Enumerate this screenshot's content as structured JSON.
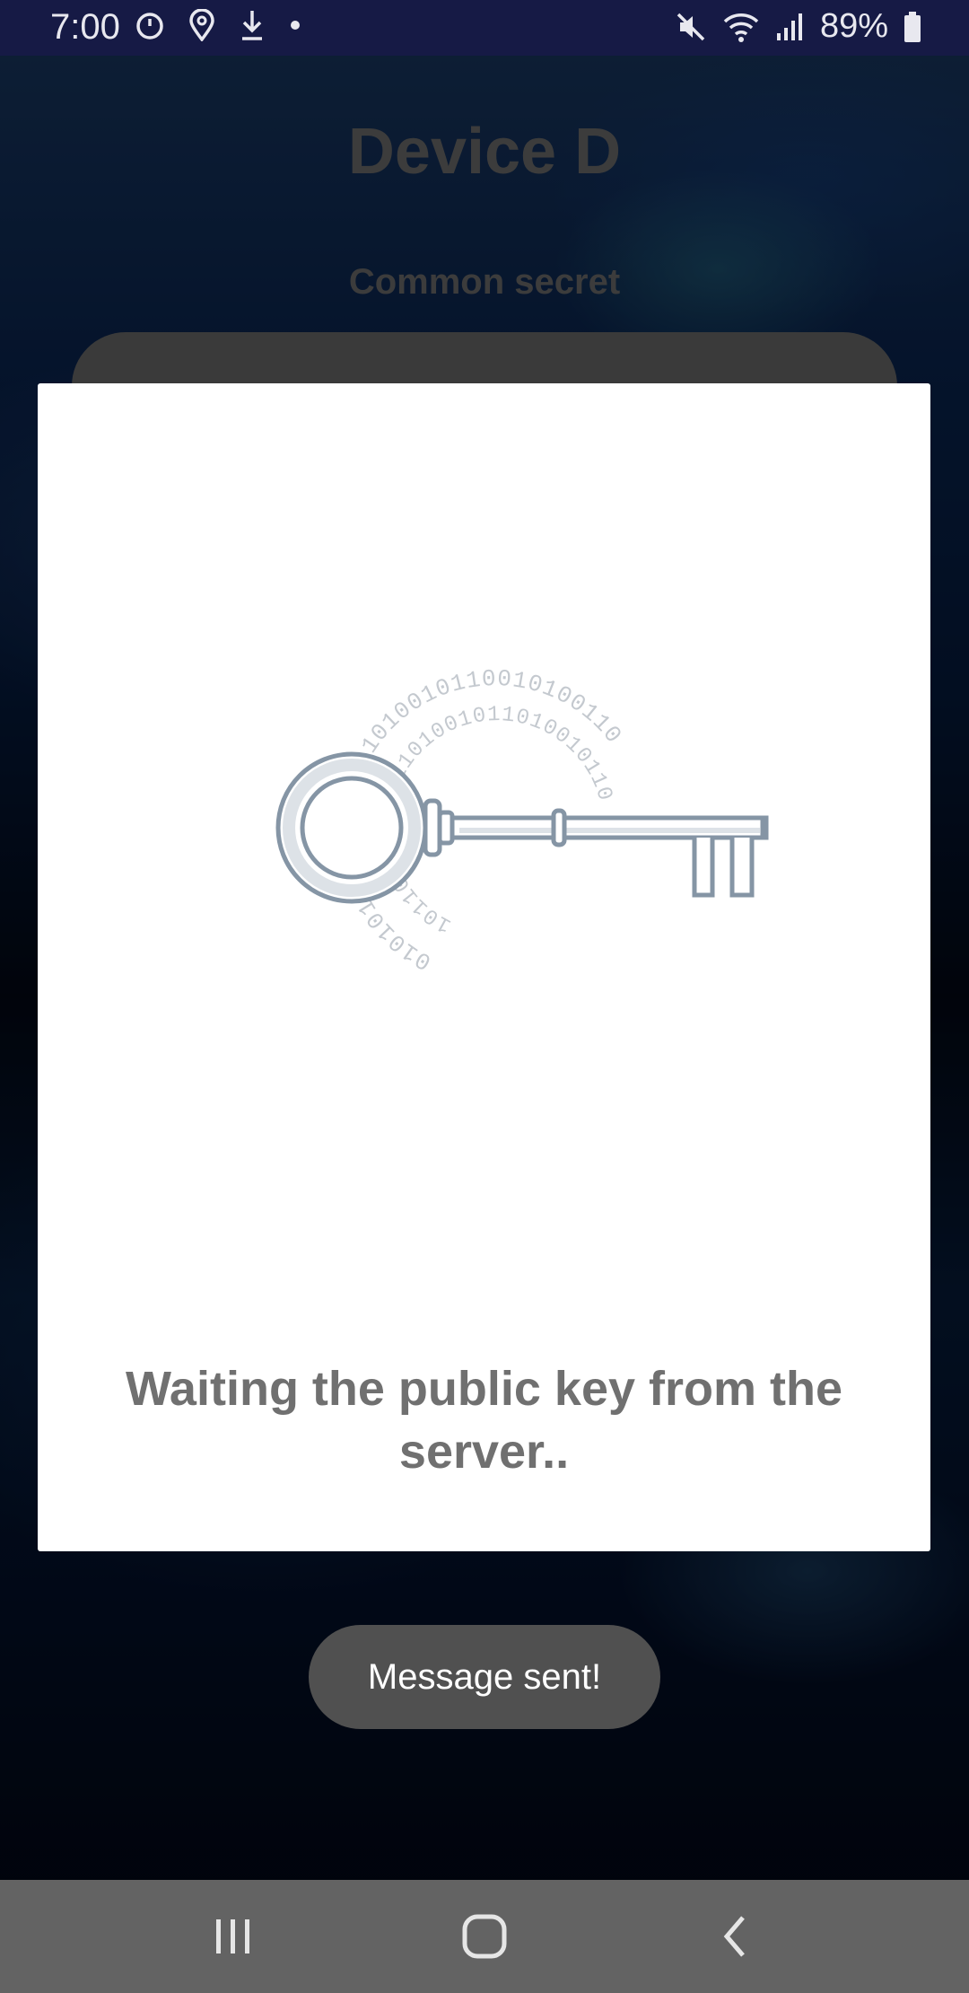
{
  "status_bar": {
    "time": "7:00",
    "battery": "89%",
    "left_icons": [
      "timer-icon",
      "location-icon",
      "download-icon",
      "dot-icon"
    ],
    "right_icons": [
      "mute-icon",
      "wifi-icon",
      "signal-icon",
      "battery-icon"
    ]
  },
  "screen": {
    "title": "Device D",
    "label": "Common secret"
  },
  "dialog": {
    "message": "Waiting the public key from the server..",
    "illustration": "binary-key-icon"
  },
  "toast": {
    "text": "Message sent!"
  },
  "nav_bar": {
    "buttons": [
      "recent-apps",
      "home",
      "back"
    ]
  },
  "colors": {
    "status_bar": "#161a45",
    "dialog_bg": "#ffffff",
    "dialog_text": "#707070",
    "toast_bg": "#505050",
    "nav_bar": "#636363",
    "key_stroke": "#8595a5"
  }
}
